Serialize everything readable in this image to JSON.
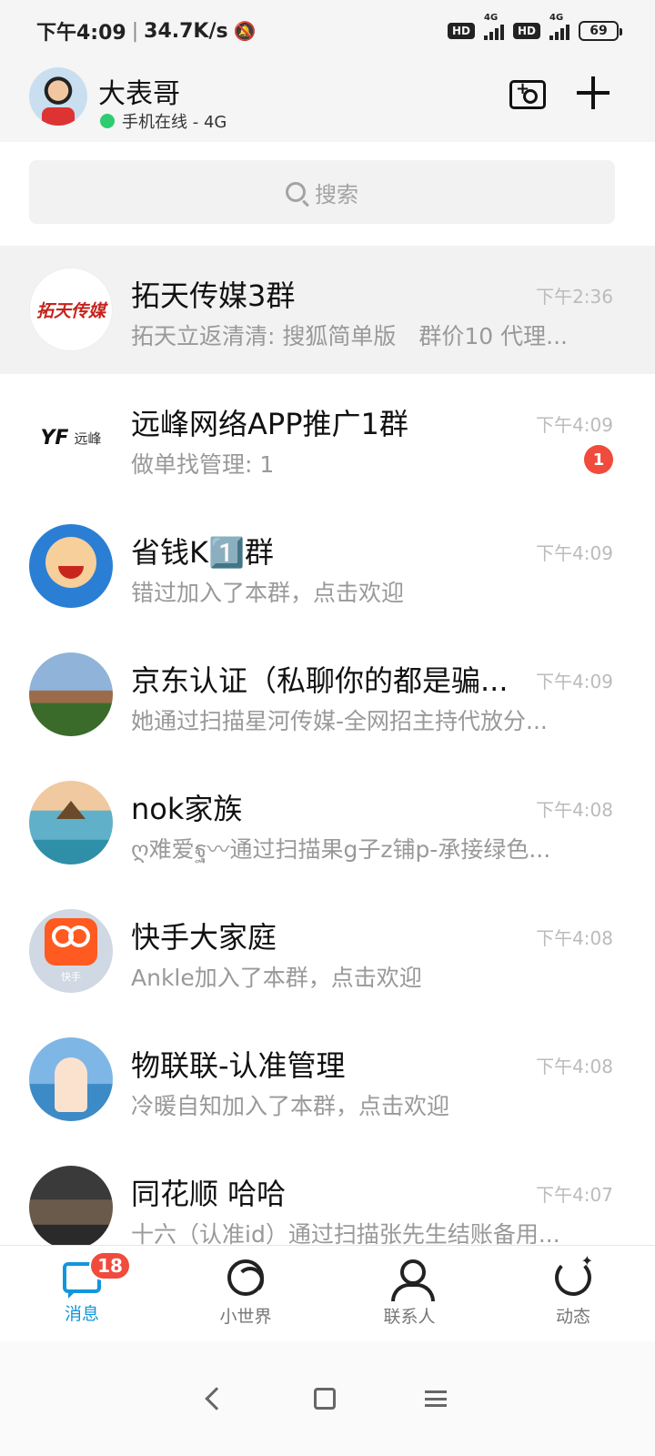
{
  "status_bar": {
    "time": "下午4:09",
    "network_speed": "34.7K/s",
    "hd1": "HD",
    "hd2": "HD",
    "net1": "4G",
    "net2": "4G",
    "battery": "69"
  },
  "header": {
    "name": "大表哥",
    "online_status": "手机在线 - 4G",
    "online_color": "#2ecc71"
  },
  "search": {
    "placeholder": "搜索"
  },
  "chats": [
    {
      "avatar_text": "拓天传媒",
      "title": "拓天传媒3群",
      "time": "下午2:36",
      "preview": "拓天立返清清: 搜狐简单版　群价10  代理...",
      "pinned": true,
      "unread": ""
    },
    {
      "avatar_text": "YF",
      "avatar_sub": "远峰",
      "title": "远峰网络APP推广1群",
      "time": "下午4:09",
      "preview": "做单找管理: 1",
      "unread": "1"
    },
    {
      "title": "省钱K1️⃣群",
      "time": "下午4:09",
      "preview": "错过加入了本群，点击欢迎",
      "unread": ""
    },
    {
      "title": "京东认证（私聊你的都是骗...",
      "time": "下午4:09",
      "preview": "她通过扫描星河传媒-全网招主持代放分...",
      "unread": ""
    },
    {
      "title": "nok家族",
      "time": "下午4:08",
      "preview": "ღ难爱ฐ〰通过扫描果g子z铺p-承接绿色...",
      "unread": ""
    },
    {
      "avatar_text": "快手",
      "title": "快手大家庭",
      "time": "下午4:08",
      "preview": "Ankle加入了本群，点击欢迎",
      "unread": ""
    },
    {
      "title": "物联联-认准管理",
      "time": "下午4:08",
      "preview": "冷暖自知加入了本群，点击欢迎",
      "unread": ""
    },
    {
      "title": "同花顺 哈哈",
      "time": "下午4:07",
      "preview": "十六（认准id）通过扫描张先生结账备用...",
      "unread": ""
    }
  ],
  "tabbar": {
    "tabs": [
      {
        "label": "消息",
        "icon": "message-icon",
        "active": true,
        "badge": "18"
      },
      {
        "label": "小世界",
        "icon": "world-icon"
      },
      {
        "label": "联系人",
        "icon": "contacts-icon"
      },
      {
        "label": "动态",
        "icon": "feed-icon"
      }
    ],
    "accent": "#1296db",
    "badge_color": "#f04b3d"
  }
}
